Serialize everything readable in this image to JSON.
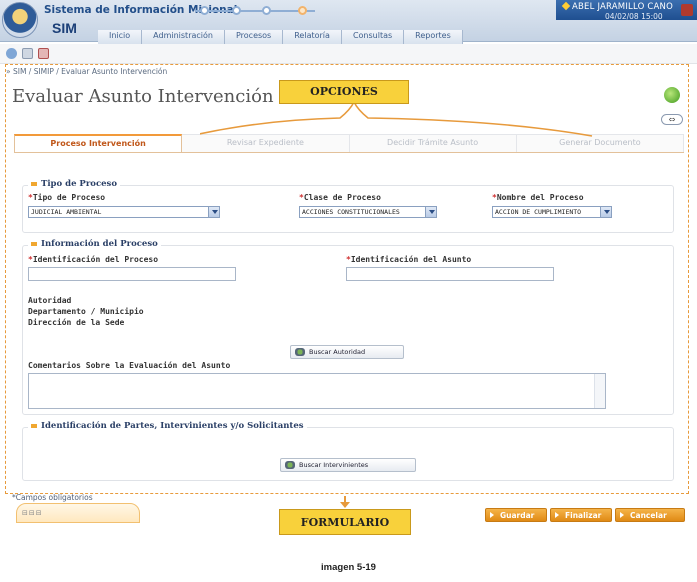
{
  "header": {
    "app_title": "Sistema de Información Misional",
    "logo_text": "SIM",
    "user_name": "ABEL JARAMILLO CANO",
    "user_date": "04/02/08 15:00",
    "menu": [
      "Inicio",
      "Administración",
      "Procesos",
      "Relatoría",
      "Consultas",
      "Reportes"
    ]
  },
  "breadcrumb": "» SIM / SIMIP / Evaluar Asunto Intervención",
  "page_title": "Evaluar Asunto Intervención",
  "annotations": {
    "opciones": "OPCIONES",
    "formulario": "FORMULARIO"
  },
  "tabs": [
    {
      "label": "Proceso Intervención",
      "active": true
    },
    {
      "label": "Revisar Expediente",
      "active": false
    },
    {
      "label": "Decidir Trámite Asunto",
      "active": false
    },
    {
      "label": "Generar Documento",
      "active": false
    }
  ],
  "tipo_proceso": {
    "legend": "Tipo de Proceso",
    "tipo_label": "Tipo de Proceso",
    "tipo_value": "JUDICIAL AMBIENTAL",
    "clase_label": "Clase de Proceso",
    "clase_value": "ACCIONES CONSTITUCIONALES",
    "nombre_label": "Nombre del Proceso",
    "nombre_value": "ACCION DE CUMPLIMIENTO"
  },
  "info_proceso": {
    "legend": "Información del Proceso",
    "id_proceso_label": "Identificación del Proceso",
    "id_asunto_label": "Identificación del Asunto",
    "autoridad_label": "Autoridad",
    "depto_label": "Departamento / Municipio",
    "direccion_label": "Dirección de la Sede",
    "buscar_autoridad": "Buscar Autoridad",
    "comentarios_label": "Comentarios Sobre la Evaluación del Asunto"
  },
  "partes": {
    "legend": "Identificación de Partes, Intervinientes y/o Solicitantes",
    "buscar_intervinientes": "Buscar Intervinientes"
  },
  "footer": {
    "required_note": "*Campos obligatorios",
    "tab_icons": "⊟⊟⊟",
    "guardar": "Guardar",
    "finalizar": "Finalizar",
    "cancelar": "Cancelar"
  },
  "caption": "imagen 5-19",
  "colors": {
    "accent_orange": "#f29a3a",
    "callout_yellow": "#f8d13b",
    "header_blue": "#234f8a"
  }
}
